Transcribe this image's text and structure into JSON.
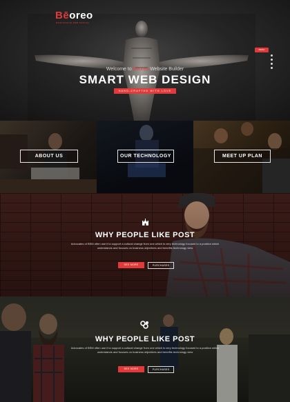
{
  "brand": {
    "logo_b": "Bē",
    "logo_rest": "oreo",
    "subtitle": "RESPONSIVE WEB DESIGN"
  },
  "hero": {
    "menu_label": "MENU",
    "welcome_pre": "Welcome to ",
    "welcome_brand": "Beoreo",
    "welcome_post": " Website Builder",
    "title": "SMART WEB DESIGN",
    "tagline": "HAND-CRAFTED WITH LOVE"
  },
  "tiles": [
    {
      "label": "ABOUT US"
    },
    {
      "label": "OUR TECHNOLOGY"
    },
    {
      "label": "MEET UP PLAN"
    }
  ],
  "section2": {
    "icon": "castle-icon",
    "title": "WHY PEOPLE LIKE POST",
    "text": "Advocates of BSM often use it to support a cultural change from one which is very technology focused to a position which understands and focuses on business objectives and benefits technology view",
    "btn_primary": "SEE MORE",
    "btn_secondary": "PURCHASES"
  },
  "section3": {
    "icon": "ampersand-icon",
    "title": "WHY PEOPLE LIKE POST",
    "text": "Advocates of BSM often use it to support a cultural change from one which is very technology focused to a position which understands and focuses on business objectives and benefits technology view",
    "btn_primary": "SEE MORE",
    "btn_secondary": "PURCHASES"
  },
  "colors": {
    "accent": "#e23a3a"
  }
}
